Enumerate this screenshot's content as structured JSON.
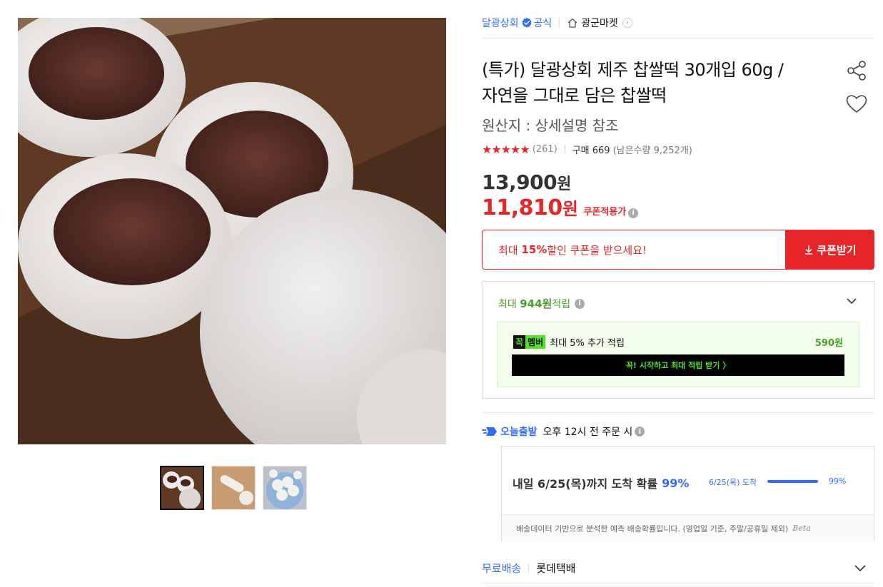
{
  "seller": {
    "name": "달광상회",
    "official_label": "공식",
    "store_name": "광군마켓"
  },
  "product": {
    "title_line1": "(특가) 달광상회 제주 찹쌀떡 30개입 60g /",
    "title_line2": "자연을 그대로 담은 찹쌀떡",
    "origin": "원산지 : 상세설명 참조"
  },
  "rating": {
    "stars": "★★★★★",
    "review_count": "(261)",
    "purchase": "구매 669",
    "remaining": "(남은수량 9,252개)"
  },
  "price": {
    "original": "13,900",
    "original_unit": "원",
    "coupon_price": "11,810",
    "coupon_unit": "원",
    "coupon_tag": "쿠폰적용가"
  },
  "coupon": {
    "prefix": "최대 ",
    "percent": "15%",
    "suffix": " 할인 쿠폰을 받으세요!",
    "button_label": "쿠폰받기"
  },
  "reward": {
    "prefix": "최대 ",
    "amount": "944원",
    "suffix": " 적립",
    "wow_badge_k": "꼭",
    "wow_badge_m": "멤버",
    "wow_text": "최대 5% 추가 적립",
    "wow_amount": "590원",
    "wow_cta": "꼭! 시작하고 최대 적립 받기 〉"
  },
  "shipping": {
    "label": "오늘출발",
    "condition": "오후 12시 전 주문 시",
    "eta_main": "내일 6/25(목)까지 도착 확률",
    "eta_percent": "99%",
    "eta_small": "6/25(목) 도착",
    "eta_bar_percent": "99%",
    "eta_bar_value": 0.99,
    "eta_footnote": "배송데이터 기반으로 분석한 예측 배송확률입니다. (영업일 기준, 주말/공휴일 제외)",
    "beta": "Beta"
  },
  "delivery": {
    "free_label": "무료배송",
    "carrier": "롯데택배"
  },
  "colors": {
    "accent_blue": "#346aff",
    "accent_red": "#e52528",
    "reward_green": "#47a12c"
  }
}
